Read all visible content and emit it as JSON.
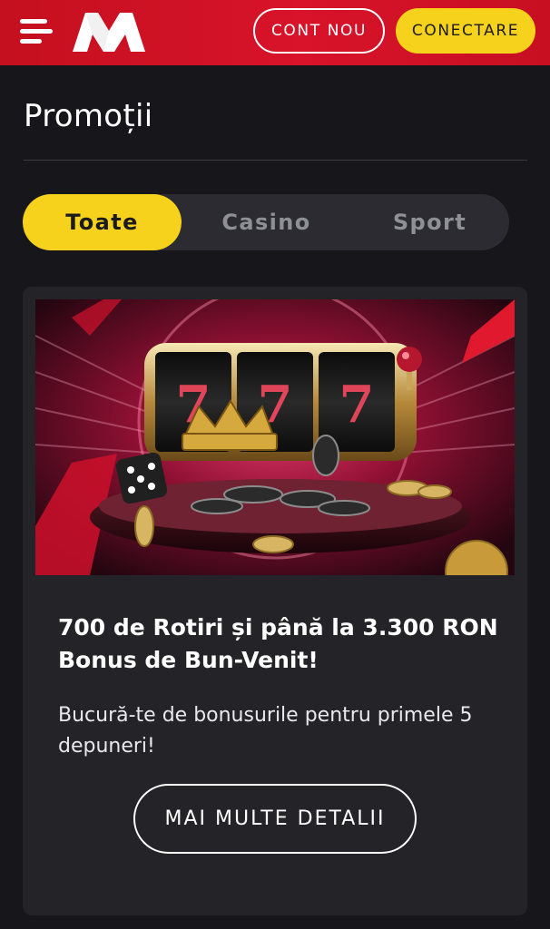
{
  "header": {
    "menu_icon": "hamburger-menu-icon",
    "logo_icon": "brand-logo-m",
    "register_label": "CONT NOU",
    "login_label": "CONECTARE",
    "colors": {
      "header_bg": "#d21124",
      "accent": "#f7d21c"
    }
  },
  "page": {
    "title": "Promoții"
  },
  "tabs": [
    {
      "label": "Toate",
      "active": true
    },
    {
      "label": "Casino",
      "active": false
    },
    {
      "label": "Sport",
      "active": false
    }
  ],
  "promo": {
    "image_icon": "slot-machine-777-illustration",
    "image_reel_symbols": [
      "7",
      "7",
      "7"
    ],
    "title": "700 de Rotiri și până la 3.300 RON Bonus de Bun-Venit!",
    "description": "Bucură-te de bonusurile pentru primele 5 depuneri!",
    "details_label": "MAI MULTE DETALII"
  }
}
